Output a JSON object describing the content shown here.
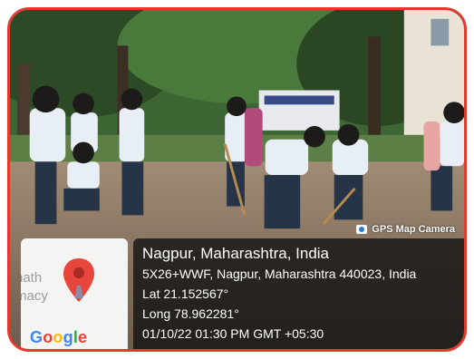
{
  "overlay": {
    "brand": "GPS Map Camera",
    "place": "Nagpur, Maharashtra, India",
    "address": "5X26+WWF, Nagpur, Maharashtra 440023, India",
    "lat": "Lat 21.152567°",
    "long": "Long 78.962281°",
    "datetime": "01/10/22 01:30 PM GMT +05:30"
  },
  "map": {
    "faded_text_1": "nath",
    "faded_text_2": "macy",
    "logo": "Google"
  },
  "colors": {
    "border": "#e23b2e",
    "pin": "#e8453c"
  }
}
